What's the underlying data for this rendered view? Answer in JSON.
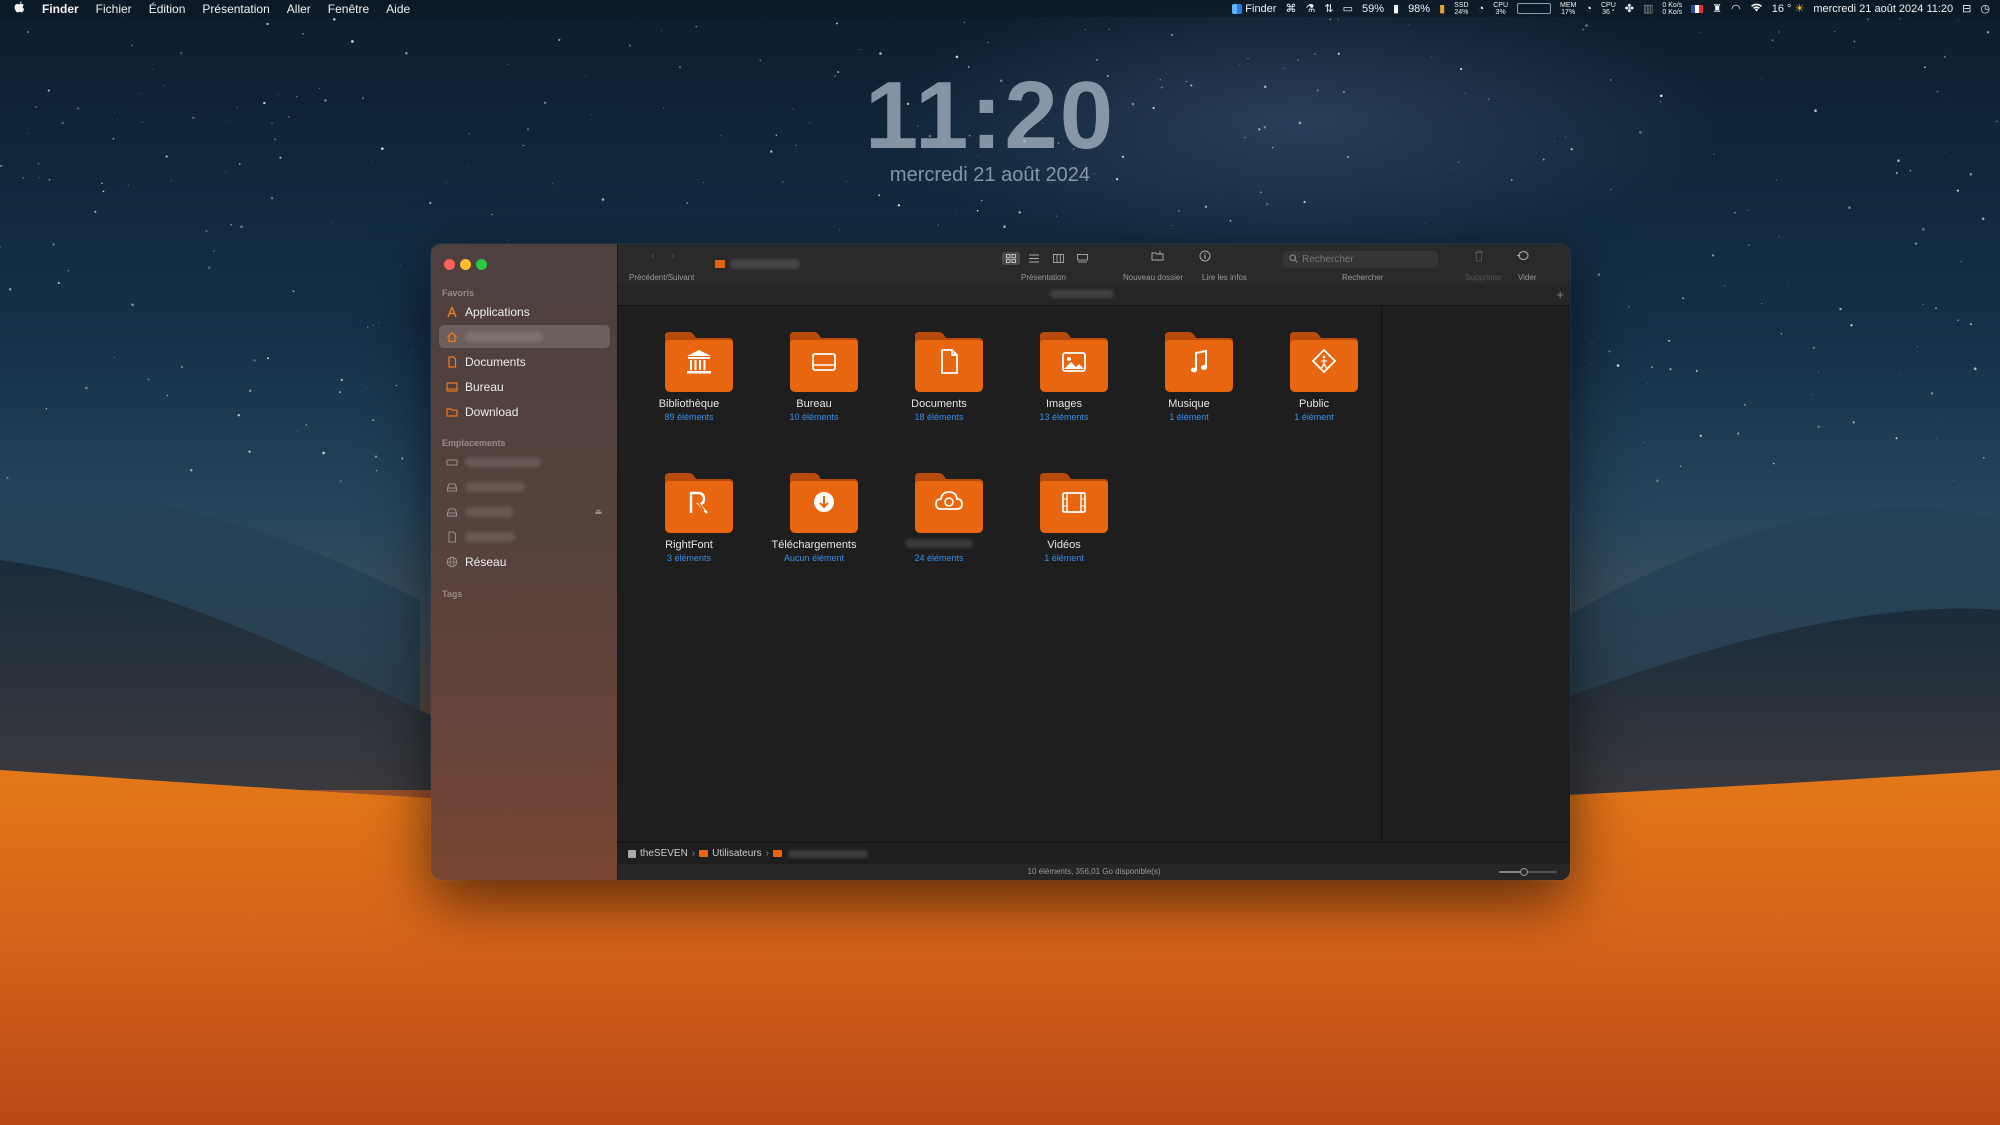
{
  "menubar": {
    "app": "Finder",
    "items": [
      "Fichier",
      "Édition",
      "Présentation",
      "Aller",
      "Fenêtre",
      "Aide"
    ],
    "status": {
      "active_app": "Finder",
      "battery1": "59%",
      "battery2": "98%",
      "ssd_label": "SSD",
      "ssd_value": "24%",
      "cpu_label": "CPU",
      "cpu_value": "3%",
      "mem_label": "MEM",
      "mem_value": "17%",
      "cpu_temp_label": "CPU",
      "cpu_temp_value": "36 °",
      "net_up": "0 Ko/s",
      "net_down": "0 Ko/s",
      "weather": "16 °",
      "datetime": "mercredi 21 août 2024  11:20"
    }
  },
  "lockscreen": {
    "time": "11:20",
    "date": "mercredi 21 août 2024"
  },
  "window": {
    "toolbar": {
      "back_forward_label": "Précédent/Suivant",
      "view_label": "Présentation",
      "new_folder_label": "Nouveau dossier",
      "info_label": "Lire les infos",
      "search_placeholder": "Rechercher",
      "search_label": "Rechercher",
      "delete_label": "Supprimer",
      "empty_label": "Vider"
    },
    "sidebar": {
      "favorites_title": "Favoris",
      "favorites": [
        {
          "label": "Applications",
          "icon": "applications-icon"
        },
        {
          "label": "",
          "icon": "home-icon"
        },
        {
          "label": "Documents",
          "icon": "document-icon"
        },
        {
          "label": "Bureau",
          "icon": "desktop-icon"
        },
        {
          "label": "Download",
          "icon": "folder-icon"
        }
      ],
      "locations_title": "Emplacements",
      "network": "Réseau",
      "tags_title": "Tags"
    },
    "folders": [
      {
        "name": "Bibliothèque",
        "count": "89 éléments",
        "icon": "library-icon"
      },
      {
        "name": "Bureau",
        "count": "10 éléments",
        "icon": "desktop-icon"
      },
      {
        "name": "Documents",
        "count": "18 éléments",
        "icon": "document-icon"
      },
      {
        "name": "Images",
        "count": "13 éléments",
        "icon": "image-icon"
      },
      {
        "name": "Musique",
        "count": "1 élément",
        "icon": "music-icon"
      },
      {
        "name": "Public",
        "count": "1 élément",
        "icon": "public-icon"
      },
      {
        "name": "RightFont",
        "count": "3 éléments",
        "icon": "rightfont-icon"
      },
      {
        "name": "Téléchargements",
        "count": "Aucun élément",
        "icon": "download-icon"
      },
      {
        "name": "",
        "count": "24 éléments",
        "icon": "creative-cloud-icon"
      },
      {
        "name": "Vidéos",
        "count": "1 élément",
        "icon": "video-icon"
      }
    ],
    "pathbar": {
      "root": "theSEVEN",
      "users": "Utilisateurs"
    },
    "status": "10 éléments, 356,01 Go disponible(s)"
  },
  "colors": {
    "accent_orange": "#e8660f",
    "link_blue": "#3a8ee8",
    "close": "#ff5f57",
    "minimize": "#febc2e",
    "zoom": "#28c840"
  }
}
